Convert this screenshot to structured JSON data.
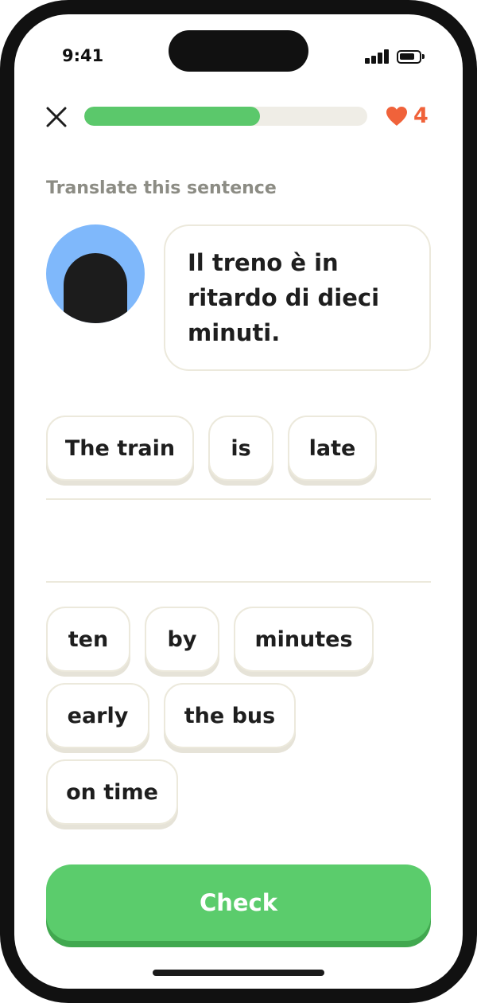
{
  "status_bar": {
    "time": "9:41",
    "icons": [
      "signal-icon",
      "battery-icon"
    ]
  },
  "header": {
    "close_icon": "close-icon",
    "progress_fraction": 0.62,
    "hearts_icon": "heart-icon",
    "hearts_count": "4"
  },
  "exercise": {
    "prompt": "Translate this sentence",
    "sentence": "Il treno è in ritardo di dieci minuti.",
    "avatar": "character-avatar"
  },
  "answer": {
    "selected": [
      "The train",
      "is",
      "late"
    ]
  },
  "word_bank": {
    "options": [
      "ten",
      "by",
      "minutes",
      "early",
      "the bus",
      "on time"
    ]
  },
  "actions": {
    "check_label": "Check"
  },
  "colors": {
    "accent_green": "#5bcc6c",
    "heart_orange": "#f0623a",
    "avatar_blue": "#7fb8fb"
  }
}
